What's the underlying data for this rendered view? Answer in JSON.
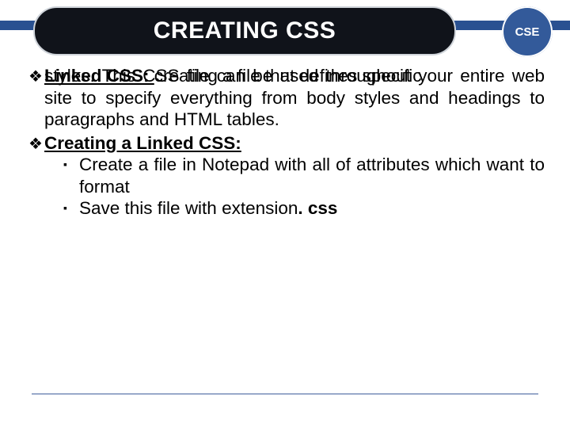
{
  "badge": "CSE",
  "title": "CREATING CSS",
  "bullets": {
    "b1_lead": "Linked CSS: ",
    "b1_rest_firstline": "creating a file that defines specific",
    "b1_rest_body": "styles. This CSS file can be used throughout your entire web site to specify everything from body styles and headings to paragraphs and HTML tables.",
    "b2_lead": "Creating a Linked CSS:",
    "sub1": "Create a file in Notepad with all of attributes which want to format",
    "sub2_a": "Save this file with extension",
    "sub2_b": ". css"
  },
  "glyphs": {
    "diamond": "❖",
    "square": "▪"
  }
}
